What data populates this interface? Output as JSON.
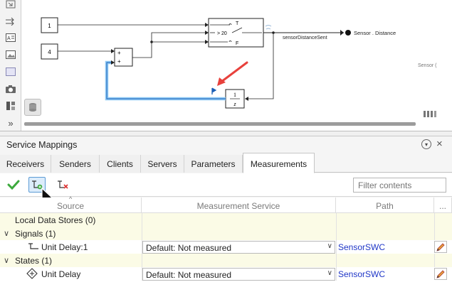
{
  "diagram": {
    "const_1": "1",
    "const_2": "4",
    "sum_signs": [
      "+",
      "+"
    ],
    "switch_ports": [
      "T",
      "> 20",
      "F"
    ],
    "signal_label": "sensorDistanceSent",
    "outport_label": "Sensor . Distance",
    "unit_delay_num": "1",
    "unit_delay_den": "z",
    "partial_label": "Sensor ("
  },
  "panel": {
    "title": "Service Mappings",
    "menu_glyph": "▾",
    "close_glyph": "×",
    "tabs": [
      "Receivers",
      "Senders",
      "Clients",
      "Servers",
      "Parameters",
      "Measurements"
    ],
    "active_tab": "Measurements",
    "filter_placeholder": "Filter contents"
  },
  "grid": {
    "headers": [
      "Source",
      "Measurement Service",
      "Path",
      "..."
    ],
    "rows": [
      {
        "kind": "group",
        "source": "Local Data Stores (0)",
        "expandable": false
      },
      {
        "kind": "group",
        "source": "Signals (1)",
        "expandable": true
      },
      {
        "kind": "data",
        "source": "Unit Delay:1",
        "service": "Default: Not measured",
        "path": "SensorSWC",
        "icon": "signal-icon"
      },
      {
        "kind": "group",
        "source": "States (1)",
        "expandable": true
      },
      {
        "kind": "data",
        "source": "Unit Delay",
        "service": "Default: Not measured",
        "path": "SensorSWC",
        "icon": "state-icon"
      }
    ]
  },
  "colors": {
    "accent": "#5b9bd5",
    "link": "#1f36c7",
    "group_row": "#fbfbe6",
    "highlight_signal": "#3a9ee8",
    "arrow": "#e8413c"
  }
}
